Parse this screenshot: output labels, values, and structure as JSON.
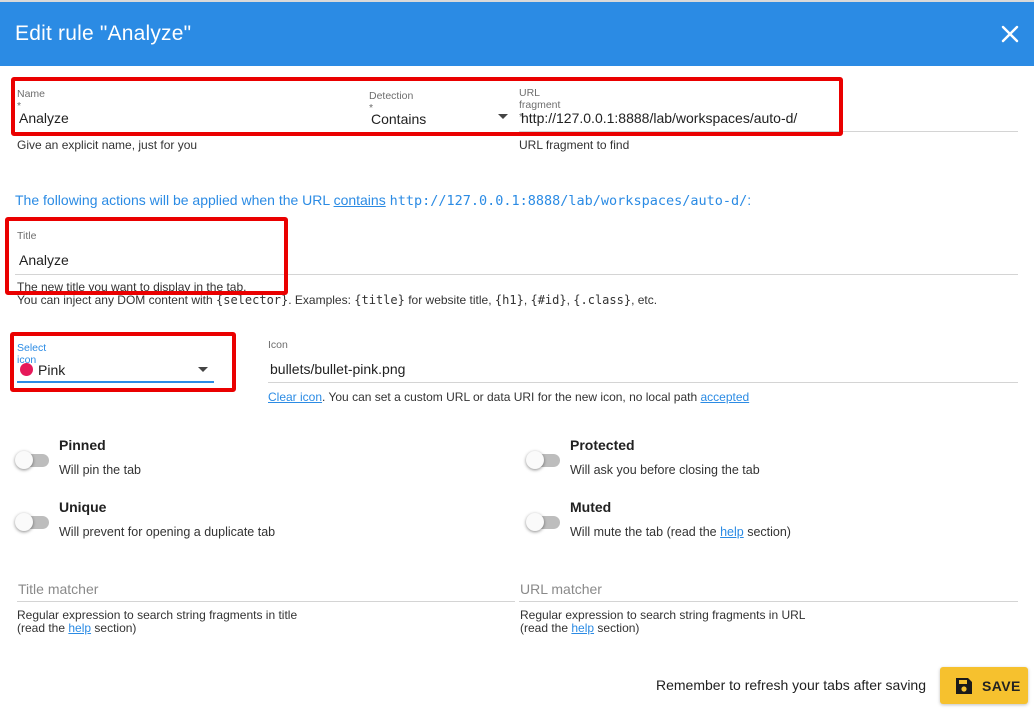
{
  "dialog": {
    "title": "Edit rule \"Analyze\""
  },
  "name_field": {
    "label": "Name *",
    "value": "Analyze",
    "hint": "Give an explicit name, just for you"
  },
  "detection_field": {
    "label": "Detection *",
    "value": "Contains"
  },
  "url_field": {
    "label": "URL fragment *",
    "value": "http://127.0.0.1:8888/lab/workspaces/auto-d/",
    "hint": "URL fragment to find"
  },
  "info": {
    "prefix": "The following actions will be applied when the URL ",
    "keyword": "contains",
    "url": "http://127.0.0.1:8888/lab/workspaces/auto-d/",
    "suffix": ":"
  },
  "title_field": {
    "label": "Title",
    "value": "Analyze",
    "hint_line1": "The new title you want to display in the tab.",
    "hint_prefix": "You can inject any DOM content with ",
    "hint_selector": "{selector}",
    "hint_examples": ". Examples: ",
    "hint_title": "{title}",
    "hint_for_website": " for website title, ",
    "hint_h1": "{h1}",
    "hint_sep1": ", ",
    "hint_id": "{#id}",
    "hint_sep2": ", ",
    "hint_class": "{.class}",
    "hint_end": ", etc."
  },
  "select_icon": {
    "label": "Select icon",
    "value": "Pink",
    "dot_color": "#e6195a"
  },
  "icon_field": {
    "label": "Icon",
    "value": "bullets/bullet-pink.png",
    "clear_link": "Clear icon",
    "hint_middle": ". You can set a custom URL or data URI for the new icon, no local path ",
    "accepted_link": "accepted"
  },
  "options": {
    "pinned": {
      "title": "Pinned",
      "desc": "Will pin the tab"
    },
    "protected": {
      "title": "Protected",
      "desc": "Will ask you before closing the tab"
    },
    "unique": {
      "title": "Unique",
      "desc": "Will prevent for opening a duplicate tab"
    },
    "muted": {
      "title": "Muted",
      "desc_prefix": "Will mute the tab (read the ",
      "desc_link": "help",
      "desc_suffix": " section)"
    }
  },
  "title_matcher": {
    "placeholder": "Title matcher",
    "hint_line1": "Regular expression to search string fragments in title",
    "hint_prefix": "(read the ",
    "hint_link": "help",
    "hint_suffix": " section)"
  },
  "url_matcher": {
    "placeholder": "URL matcher",
    "hint_line1": "Regular expression to search string fragments in URL",
    "hint_prefix": "(read the ",
    "hint_link": "help",
    "hint_suffix": " section)"
  },
  "footer": {
    "note": "Remember to refresh your tabs after saving",
    "save_label": "SAVE"
  },
  "colors": {
    "header": "#2b8be4",
    "highlight": "#ea0000",
    "save_button": "#f6c12e",
    "link": "#2b8be4"
  }
}
